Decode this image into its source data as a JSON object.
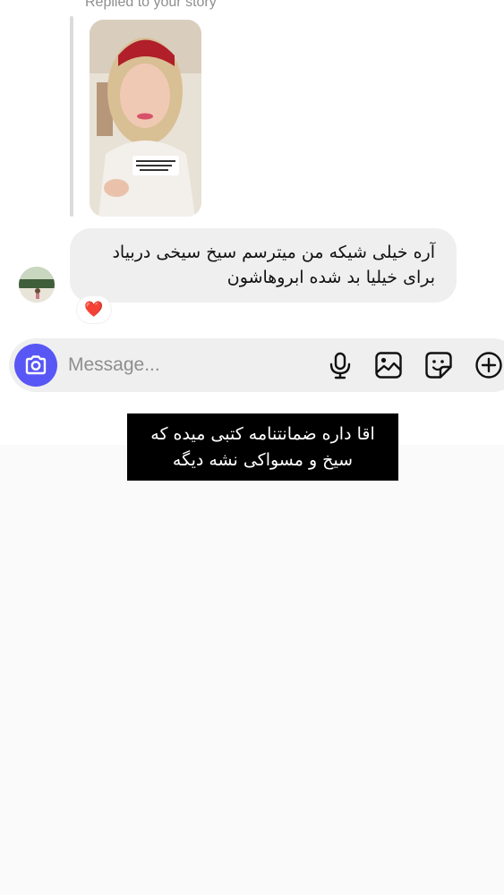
{
  "thread": {
    "replied_label": "Replied to your story",
    "story_caption": "",
    "message_text_line1": "آره خیلی شیکه من میترسم سیخ سیخی دربیاد",
    "message_text_line2": "برای خیلیا بد شده ابروهاشون",
    "reaction": "❤️"
  },
  "composer": {
    "placeholder": "Message...",
    "icons": [
      "camera-icon",
      "microphone-icon",
      "gallery-icon",
      "sticker-icon",
      "plus-icon"
    ]
  },
  "overlay_caption": {
    "line1": "اقا داره ضمانتنامه کتبی میده که",
    "line2": "سیخ و مسواکی نشه دیگه"
  },
  "colors": {
    "camera_button": "#5856f5",
    "bubble_bg": "#efefef",
    "reaction_heart": "#e8162f",
    "caption_bg": "#000000"
  }
}
